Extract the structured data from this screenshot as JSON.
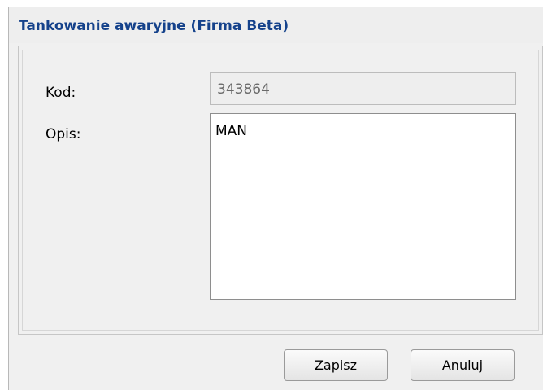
{
  "dialog": {
    "title": "Tankowanie awaryjne (Firma Beta)"
  },
  "form": {
    "kod_label": "Kod:",
    "kod_value": "343864",
    "opis_label": "Opis:",
    "opis_value": "MAN"
  },
  "buttons": {
    "save_label": "Zapisz",
    "cancel_label": "Anuluj"
  },
  "colors": {
    "title": "#15428b",
    "dialog_background": "#f0f0f0",
    "readonly_field_background": "#eeeeee"
  }
}
